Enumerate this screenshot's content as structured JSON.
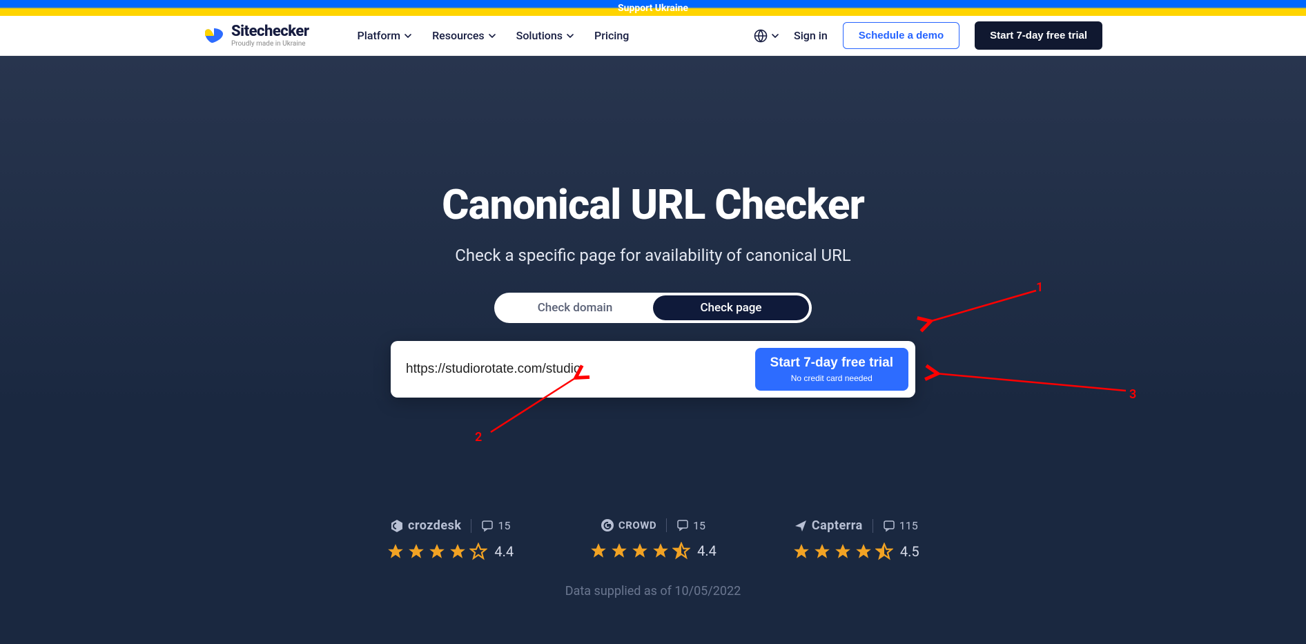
{
  "banner": {
    "text": "Support Ukraine"
  },
  "header": {
    "brand": "Sitechecker",
    "brand_tag": "Proudly made in Ukraine",
    "nav": {
      "platform": "Platform",
      "resources": "Resources",
      "solutions": "Solutions",
      "pricing": "Pricing"
    },
    "signin": "Sign in",
    "schedule": "Schedule a demo",
    "trial": "Start 7-day free trial"
  },
  "hero": {
    "title": "Canonical URL Checker",
    "subtitle": "Check a specific page for availability of canonical URL",
    "toggle": {
      "domain": "Check domain",
      "page": "Check page"
    },
    "input_value": "https://studiorotate.com/studio",
    "cta_title": "Start 7-day free trial",
    "cta_sub": "No credit card needed"
  },
  "ratings": {
    "crozdesk": {
      "name": "crozdesk",
      "reviews": "15",
      "score": "4.4"
    },
    "crowd": {
      "name": "CROWD",
      "reviews": "15",
      "score": "4.4"
    },
    "capterra": {
      "name": "Capterra",
      "reviews": "115",
      "score": "4.5"
    }
  },
  "footnote": "Data supplied as of 10/05/2022",
  "annotations": {
    "a1": "1",
    "a2": "2",
    "a3": "3"
  }
}
